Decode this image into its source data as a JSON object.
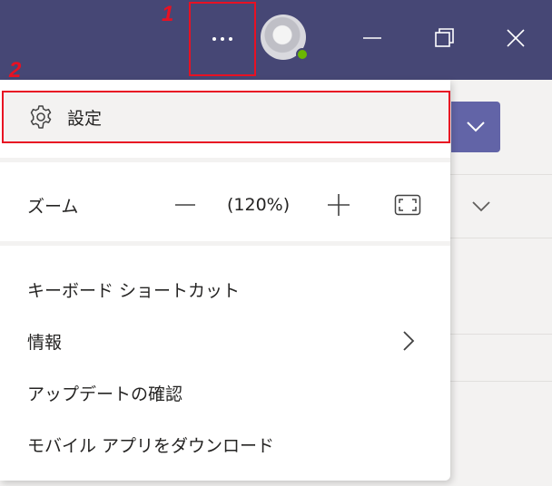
{
  "callouts": {
    "one": "1",
    "two": "2"
  },
  "titlebar": {
    "more_icon": "ellipsis-horizontal-icon",
    "avatar_status_color": "#6bb700",
    "window_controls": [
      "minimize-icon",
      "restore-icon",
      "close-icon"
    ]
  },
  "menu": {
    "settings_label": "設定",
    "settings_icon": "gear-icon",
    "zoom": {
      "label": "ズーム",
      "value": "(120%)",
      "minus_icon": "minus-icon",
      "plus_icon": "plus-icon",
      "fit_icon": "fit-to-screen-icon"
    },
    "items": [
      {
        "label": "キーボード ショートカット"
      },
      {
        "label": "情報",
        "submenu_icon": "chevron-right-icon"
      },
      {
        "label": "アップデートの確認"
      },
      {
        "label": "モバイル アプリをダウンロード"
      }
    ]
  },
  "colors": {
    "titlebar": "#464775",
    "accent": "#6264a7",
    "highlight": "#e81123",
    "menu_bg": "#ffffff",
    "selected_bg": "#f3f2f1"
  }
}
